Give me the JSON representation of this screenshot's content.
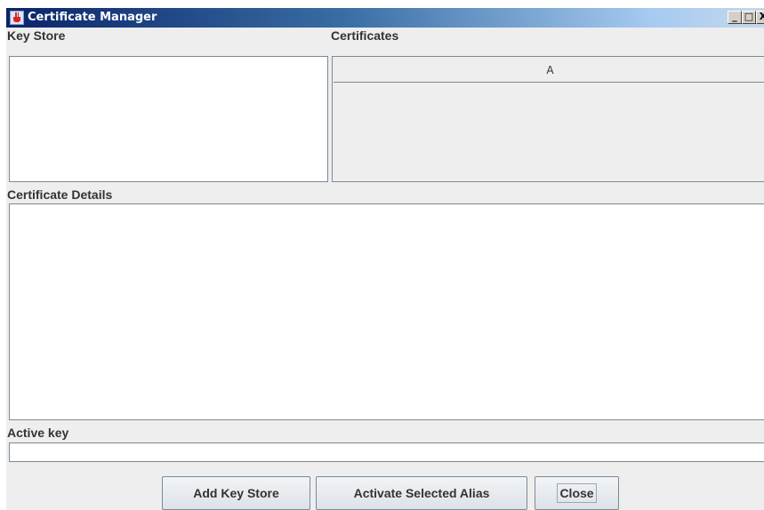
{
  "window": {
    "title": "Certificate Manager",
    "controls": {
      "minimize": "_",
      "maximize": "□",
      "close": "X"
    }
  },
  "key_store": {
    "label": "Key Store",
    "entries": []
  },
  "certificates": {
    "label": "Certificates",
    "columns": [
      "A"
    ],
    "rows": []
  },
  "details": {
    "label": "Certificate Details",
    "value": ""
  },
  "active_key": {
    "label": "Active key",
    "value": ""
  },
  "buttons": {
    "add_key_store": "Add Key Store",
    "activate_alias": "Activate Selected Alias",
    "close": "Close"
  }
}
